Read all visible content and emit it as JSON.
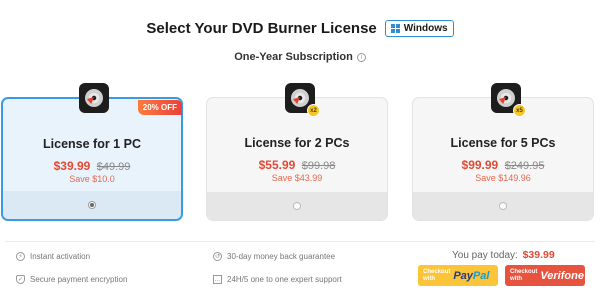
{
  "header": {
    "title": "Select Your DVD Burner License",
    "os_label": "Windows",
    "subscription_label": "One-Year Subscription",
    "info_icon": "i"
  },
  "cards": [
    {
      "name": "License for 1 PC",
      "price": "$39.99",
      "old_price": "$49.99",
      "save": "Save $10.0",
      "badge": "20% OFF",
      "selected": true,
      "icon": "dvd-disc-icon"
    },
    {
      "name": "License for 2 PCs",
      "price": "$55.99",
      "old_price": "$99.98",
      "save": "Save $43.99",
      "qty": "x2",
      "selected": false,
      "icon": "dvd-disc-icon"
    },
    {
      "name": "License for 5 PCs",
      "price": "$99.99",
      "old_price": "$249.95",
      "save": "Save $149.96",
      "qty": "x5",
      "selected": false,
      "icon": "dvd-disc-icon"
    }
  ],
  "features": [
    {
      "label": "Instant activation",
      "icon": "lightning-icon"
    },
    {
      "label": "30-day money back guarantee",
      "icon": "money-back-icon"
    },
    {
      "label": "Secure payment encryption",
      "icon": "shield-icon"
    },
    {
      "label": "24H/5 one to one expert support",
      "icon": "chat-icon"
    }
  ],
  "checkout": {
    "pay_today_label": "You pay today:",
    "pay_today_amount": "$39.99",
    "paypal_small_1": "Checkout",
    "paypal_small_2": "with",
    "paypal_brand_1": "Pay",
    "paypal_brand_2": "Pal",
    "verifone_small_1": "Checkout",
    "verifone_small_2": "with",
    "verifone_brand": "Verifone"
  },
  "colors": {
    "accent_blue": "#3a9be3",
    "price_red": "#e24a35",
    "paypal_yellow": "#fcc439",
    "verifone_red": "#e6533f"
  }
}
